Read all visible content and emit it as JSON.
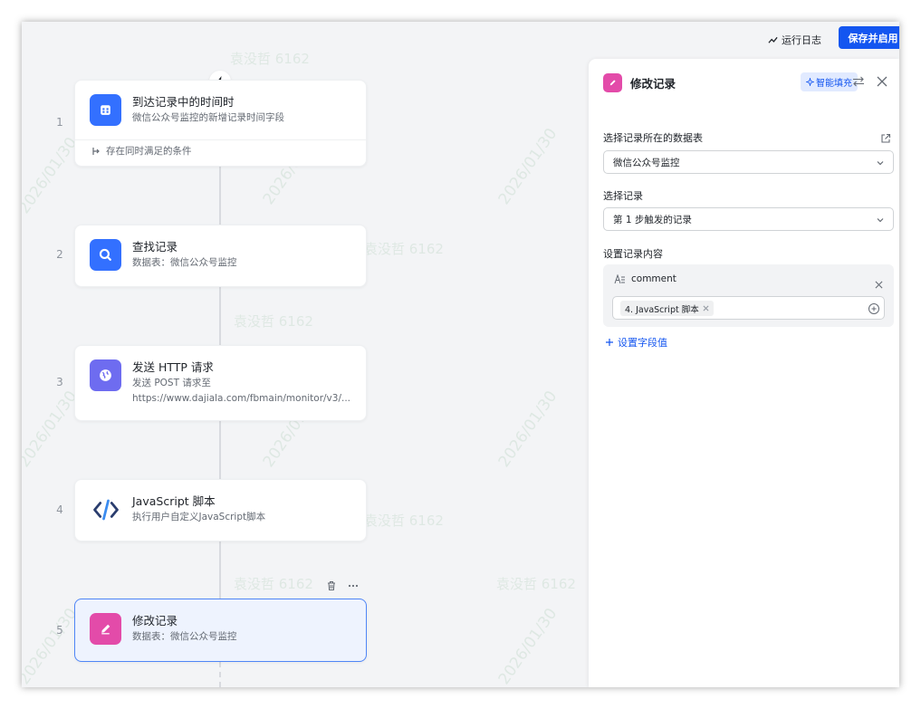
{
  "topbar": {
    "log_label": "运行日志",
    "save_label": "保存并启用"
  },
  "colors": {
    "primary": "#1456f0",
    "trigger_icon": "#3370ff",
    "find_icon": "#3370ff",
    "http_icon": "#6e6cf0",
    "modify_icon": "#e34ba9",
    "js_icon": "#3b6cc9"
  },
  "steps": [
    {
      "num": "1",
      "title": "到达记录中的时间时",
      "subtitle": "微信公众号监控的新增记录时间字段",
      "condition": "存在同时满足的条件",
      "icon": "calendar-icon"
    },
    {
      "num": "2",
      "title": "查找记录",
      "subtitle": "数据表：微信公众号监控",
      "icon": "search-icon"
    },
    {
      "num": "3",
      "title": "发送 HTTP 请求",
      "subtitle": "发送 POST 请求至",
      "subtitle2": "https://www.dajiala.com/fbmain/monitor/v3/...",
      "icon": "globe-icon"
    },
    {
      "num": "4",
      "title": "JavaScript 脚本",
      "subtitle": "执行用户自定义JavaScript脚本",
      "icon": "code-icon"
    },
    {
      "num": "5",
      "title": "修改记录",
      "subtitle": "数据表：微信公众号监控",
      "icon": "edit-icon"
    }
  ],
  "panel": {
    "title": "修改记录",
    "ai_fill": "智能填充",
    "table_label": "选择记录所在的数据表",
    "table_value": "微信公众号监控",
    "record_label": "选择记录",
    "record_value": "第 1 步触发的记录",
    "content_label": "设置记录内容",
    "field_name": "comment",
    "field_tag": "4. JavaScript 脚本",
    "add_field": "设置字段值"
  },
  "watermark": {
    "name": "袁没哲 6162",
    "date": "2026/01/30"
  }
}
